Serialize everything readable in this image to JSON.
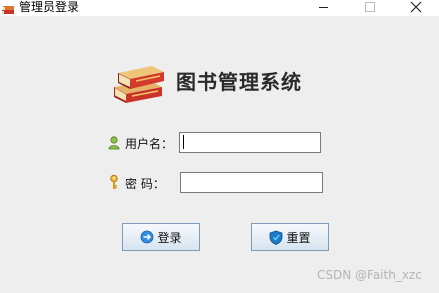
{
  "window": {
    "title": "管理员登录",
    "icon": "books-icon",
    "controls": [
      "minimize-icon",
      "maximize-icon",
      "close-icon"
    ]
  },
  "header": {
    "logo": "books-stack-icon",
    "title": "图书管理系统"
  },
  "form": {
    "username_label": "用户名：",
    "username_icon": "user-icon",
    "username_value": "",
    "password_label": "密 码：",
    "password_icon": "key-icon",
    "password_value": ""
  },
  "buttons": {
    "login_label": "登录",
    "login_icon": "login-arrow-icon",
    "reset_label": "重置",
    "reset_icon": "shield-icon"
  },
  "watermark": "CSDN @Faith_xzc",
  "colors": {
    "background": "#eeeeee",
    "button_border": "#7f9db9",
    "book_red": "#c8342a",
    "book_tan": "#e8b86a"
  }
}
